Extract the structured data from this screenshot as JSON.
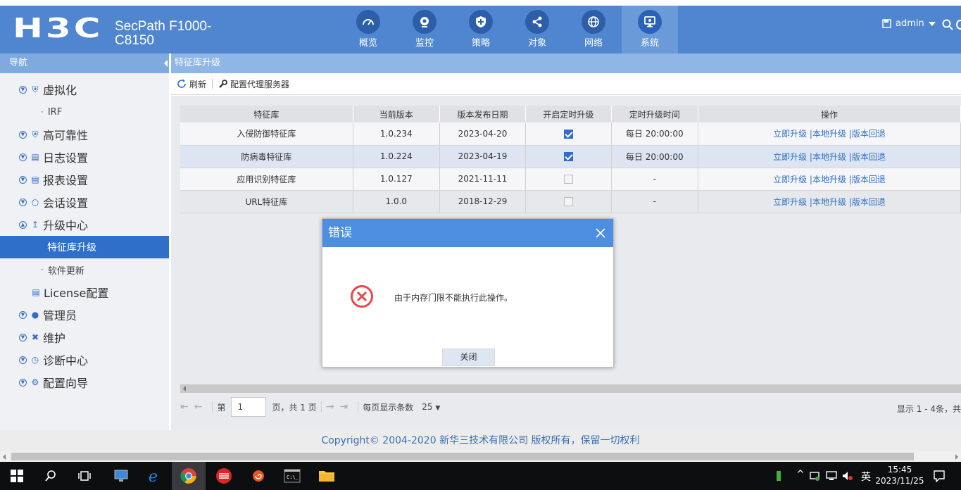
{
  "header": {
    "logo": "H3C",
    "product_line1": "SecPath F1000-",
    "product_line2": "C8150",
    "user": "admin",
    "nav": [
      {
        "label": "概览"
      },
      {
        "label": "监控"
      },
      {
        "label": "策略"
      },
      {
        "label": "对象"
      },
      {
        "label": "网络"
      },
      {
        "label": "系统"
      }
    ]
  },
  "sidebar": {
    "title": "导航",
    "items": [
      {
        "label": "虚拟化"
      },
      {
        "label": "IRF"
      },
      {
        "label": "高可靠性"
      },
      {
        "label": "日志设置"
      },
      {
        "label": "报表设置"
      },
      {
        "label": "会话设置"
      },
      {
        "label": "升级中心"
      },
      {
        "label": "特征库升级"
      },
      {
        "label": "软件更新"
      },
      {
        "label": "License配置"
      },
      {
        "label": "管理员"
      },
      {
        "label": "维护"
      },
      {
        "label": "诊断中心"
      },
      {
        "label": "配置向导"
      }
    ]
  },
  "main": {
    "breadcrumb": "特征库升级",
    "toolbar": {
      "refresh": "刷新",
      "proxy": "配置代理服务器"
    },
    "table": {
      "headers": [
        "特征库",
        "当前版本",
        "版本发布日期",
        "开启定时升级",
        "定时升级时间",
        "操作"
      ],
      "rows": [
        {
          "name": "入侵防御特征库",
          "version": "1.0.234",
          "date": "2023-04-20",
          "scheduled": true,
          "time": "每日 20:00:00"
        },
        {
          "name": "防病毒特征库",
          "version": "1.0.224",
          "date": "2023-04-19",
          "scheduled": true,
          "time": "每日 20:00:00"
        },
        {
          "name": "应用识别特征库",
          "version": "1.0.127",
          "date": "2021-11-11",
          "scheduled": false,
          "time": "-"
        },
        {
          "name": "URL特征库",
          "version": "1.0.0",
          "date": "2018-12-29",
          "scheduled": false,
          "time": "-"
        }
      ],
      "actions": {
        "upgrade": "立即升级",
        "local": "本地升级",
        "rollback": "版本回退",
        "sep": "|"
      }
    },
    "pager": {
      "page_prefix": "第",
      "page": "1",
      "page_suffix": "页，共 1 页",
      "per_page_label": "每页显示条数",
      "per_page": "25",
      "info": "显示 1 - 4条，共"
    }
  },
  "footer": {
    "copyright": "Copyright© 2004-2020 新华三技术有限公司 版权所有，保留一切权利"
  },
  "dialog": {
    "title": "错误",
    "message": "由于内存门限不能执行此操作。",
    "close_button": "关闭"
  },
  "taskbar": {
    "time": "15:45",
    "date": "2023/11/25",
    "ime": "英"
  }
}
